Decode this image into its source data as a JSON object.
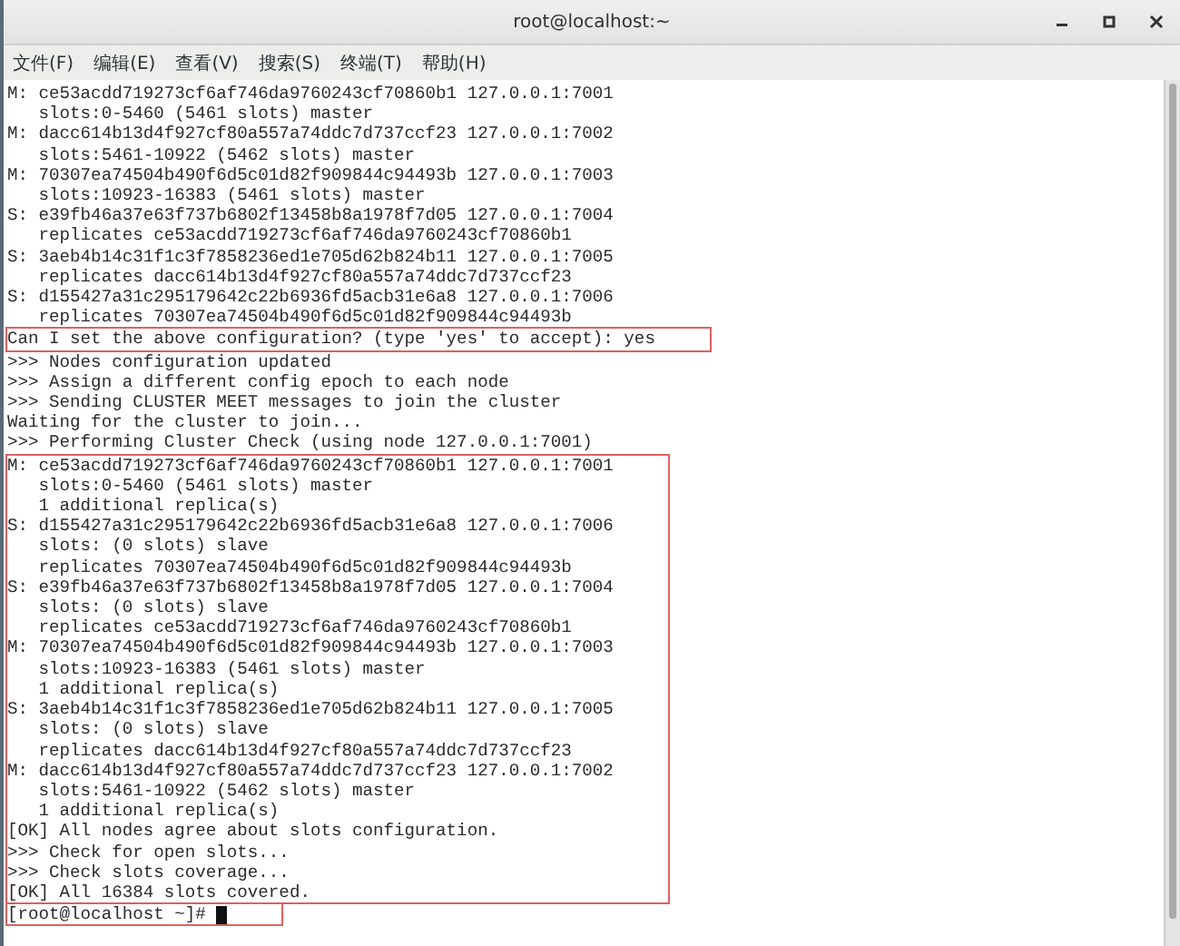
{
  "window": {
    "title": "root@localhost:~",
    "controls": [
      {
        "kind": "minimize"
      },
      {
        "kind": "maximize"
      },
      {
        "kind": "close"
      }
    ]
  },
  "menu": [
    "文件(F)",
    "编辑(E)",
    "查看(V)",
    "搜索(S)",
    "终端(T)",
    "帮助(H)"
  ],
  "terminal": {
    "blocks": [
      {
        "boxed": false,
        "lines": [
          {
            "text": "M: ce53acdd719273cf6af746da9760243cf70860b1 127.0.0.1:7001"
          },
          {
            "text": "   slots:0-5460 (5461 slots) master"
          },
          {
            "text": "M: dacc614b13d4f927cf80a557a74ddc7d737ccf23 127.0.0.1:7002"
          },
          {
            "text": "   slots:5461-10922 (5462 slots) master"
          },
          {
            "text": "M: 70307ea74504b490f6d5c01d82f909844c94493b 127.0.0.1:7003"
          },
          {
            "text": "   slots:10923-16383 (5461 slots) master"
          },
          {
            "text": "S: e39fb46a37e63f737b6802f13458b8a1978f7d05 127.0.0.1:7004"
          },
          {
            "text": "   replicates ce53acdd719273cf6af746da9760243cf70860b1"
          },
          {
            "text": "S: 3aeb4b14c31f1c3f7858236ed1e705d62b824b11 127.0.0.1:7005"
          },
          {
            "text": "   replicates dacc614b13d4f927cf80a557a74ddc7d737ccf23"
          },
          {
            "text": "S: d155427a31c295179642c22b6936fd5acb31e6a8 127.0.0.1:7006"
          },
          {
            "text": "   replicates 70307ea74504b490f6d5c01d82f909844c94493b"
          }
        ]
      },
      {
        "boxed": true,
        "lines": [
          {
            "text": "Can I set the above configuration? (type 'yes' to accept): yes"
          }
        ]
      },
      {
        "boxed": false,
        "lines": [
          {
            "text": ">>> Nodes configuration updated"
          },
          {
            "text": ">>> Assign a different config epoch to each node"
          },
          {
            "text": ">>> Sending CLUSTER MEET messages to join the cluster"
          },
          {
            "text": "Waiting for the cluster to join..."
          },
          {
            "text": ">>> Performing Cluster Check (using node 127.0.0.1:7001)"
          }
        ]
      },
      {
        "boxed": true,
        "lines": [
          {
            "text": "M: ce53acdd719273cf6af746da9760243cf70860b1 127.0.0.1:7001"
          },
          {
            "text": "   slots:0-5460 (5461 slots) master"
          },
          {
            "text": "   1 additional replica(s)"
          },
          {
            "text": "S: d155427a31c295179642c22b6936fd5acb31e6a8 127.0.0.1:7006"
          },
          {
            "text": "   slots: (0 slots) slave"
          },
          {
            "text": "   replicates 70307ea74504b490f6d5c01d82f909844c94493b"
          },
          {
            "text": "S: e39fb46a37e63f737b6802f13458b8a1978f7d05 127.0.0.1:7004"
          },
          {
            "text": "   slots: (0 slots) slave"
          },
          {
            "text": "   replicates ce53acdd719273cf6af746da9760243cf70860b1"
          },
          {
            "text": "M: 70307ea74504b490f6d5c01d82f909844c94493b 127.0.0.1:7003"
          },
          {
            "text": "   slots:10923-16383 (5461 slots) master"
          },
          {
            "text": "   1 additional replica(s)"
          },
          {
            "text": "S: 3aeb4b14c31f1c3f7858236ed1e705d62b824b11 127.0.0.1:7005"
          },
          {
            "text": "   slots: (0 slots) slave"
          },
          {
            "text": "   replicates dacc614b13d4f927cf80a557a74ddc7d737ccf23"
          },
          {
            "text": "M: dacc614b13d4f927cf80a557a74ddc7d737ccf23 127.0.0.1:7002"
          },
          {
            "text": "   slots:5461-10922 (5462 slots) master"
          },
          {
            "text": "   1 additional replica(s)"
          },
          {
            "text": "[OK] All nodes agree about slots configuration."
          },
          {
            "text": ">>> Check for open slots..."
          },
          {
            "text": ">>> Check slots coverage..."
          },
          {
            "text": "[OK] All 16384 slots covered."
          }
        ]
      },
      {
        "boxed": true,
        "lines": [
          {
            "text": "[root@localhost ~]#",
            "cursor": true
          }
        ]
      }
    ]
  }
}
